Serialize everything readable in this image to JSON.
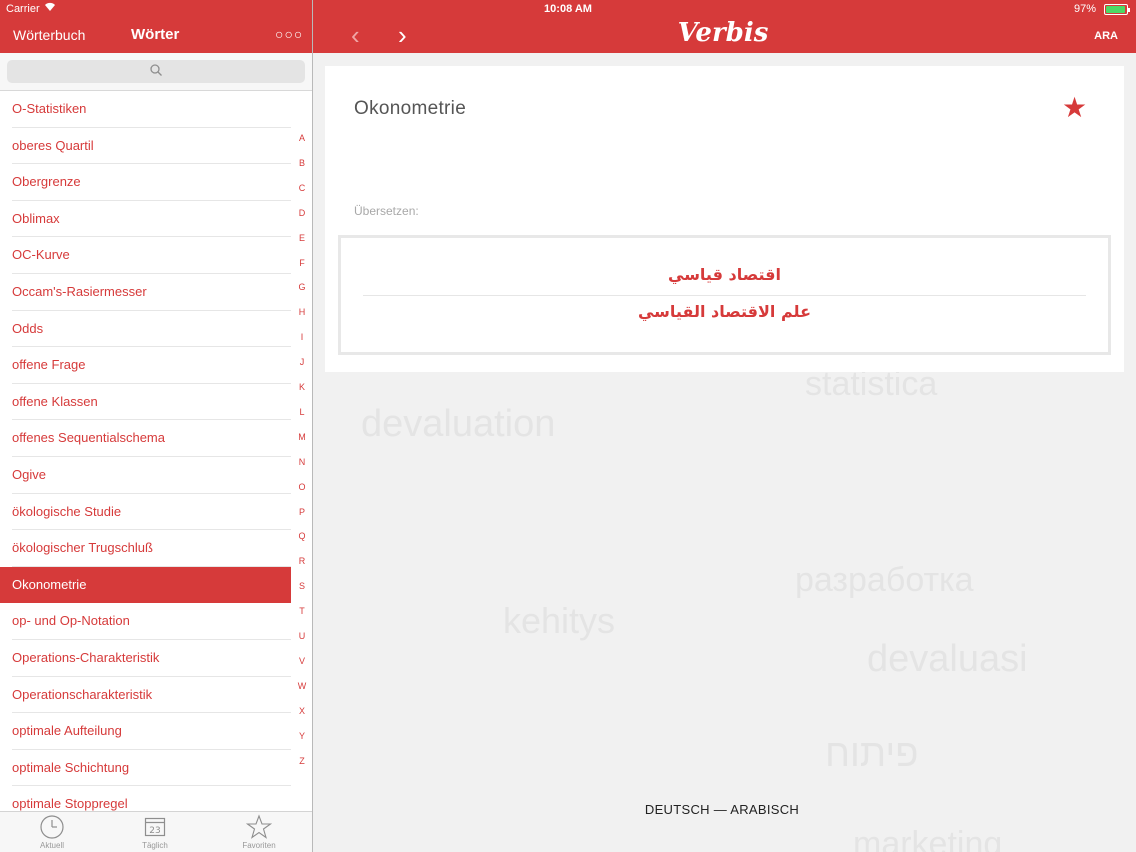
{
  "status": {
    "carrier": "Carrier",
    "time": "10:08 AM",
    "battery_pct": "97%",
    "battery_level": 0.97
  },
  "sidebar_header": {
    "left_tab": "Wörterbuch",
    "title": "Wörter"
  },
  "main_header": {
    "logo": "Verbis",
    "language_button": "ARA"
  },
  "words": [
    "O-Statistiken",
    "oberes Quartil",
    "Obergrenze",
    "Oblimax",
    "OC-Kurve",
    "Occam's-Rasiermesser",
    "Odds",
    "offene Frage",
    "offene Klassen",
    "offenes Sequentialschema",
    "Ogive",
    "ökologische Studie",
    "ökologischer Trugschluß",
    "Okonometrie",
    "op- und Op-Notation",
    "Operations-Charakteristik",
    "Operationscharakteristik",
    "optimale Aufteilung",
    "optimale Schichtung",
    "optimale Stoppregel"
  ],
  "selected_word_index": 13,
  "alphabet": [
    "A",
    "B",
    "C",
    "D",
    "E",
    "F",
    "G",
    "H",
    "I",
    "J",
    "K",
    "L",
    "M",
    "N",
    "O",
    "P",
    "Q",
    "R",
    "S",
    "T",
    "U",
    "V",
    "W",
    "X",
    "Y",
    "Z"
  ],
  "tabs": [
    {
      "label": "Aktuell",
      "icon": "clock-icon"
    },
    {
      "label": "Täglich",
      "icon": "calendar-icon",
      "badge": "23"
    },
    {
      "label": "Favoriten",
      "icon": "star-icon"
    }
  ],
  "entry": {
    "term": "Okonometrie",
    "translate_label": "Übersetzen:",
    "translations": [
      "اقتصاد قياسي",
      "علم الاقتصاد القياسي"
    ]
  },
  "background_words": [
    "statistica",
    "devaluation",
    "разработка",
    "kehitys",
    "devaluasi",
    "פיתוח",
    "marketing"
  ],
  "footer": {
    "language_pair": "DEUTSCH — ARABISCH"
  },
  "colors": {
    "accent": "#d63a3a"
  }
}
